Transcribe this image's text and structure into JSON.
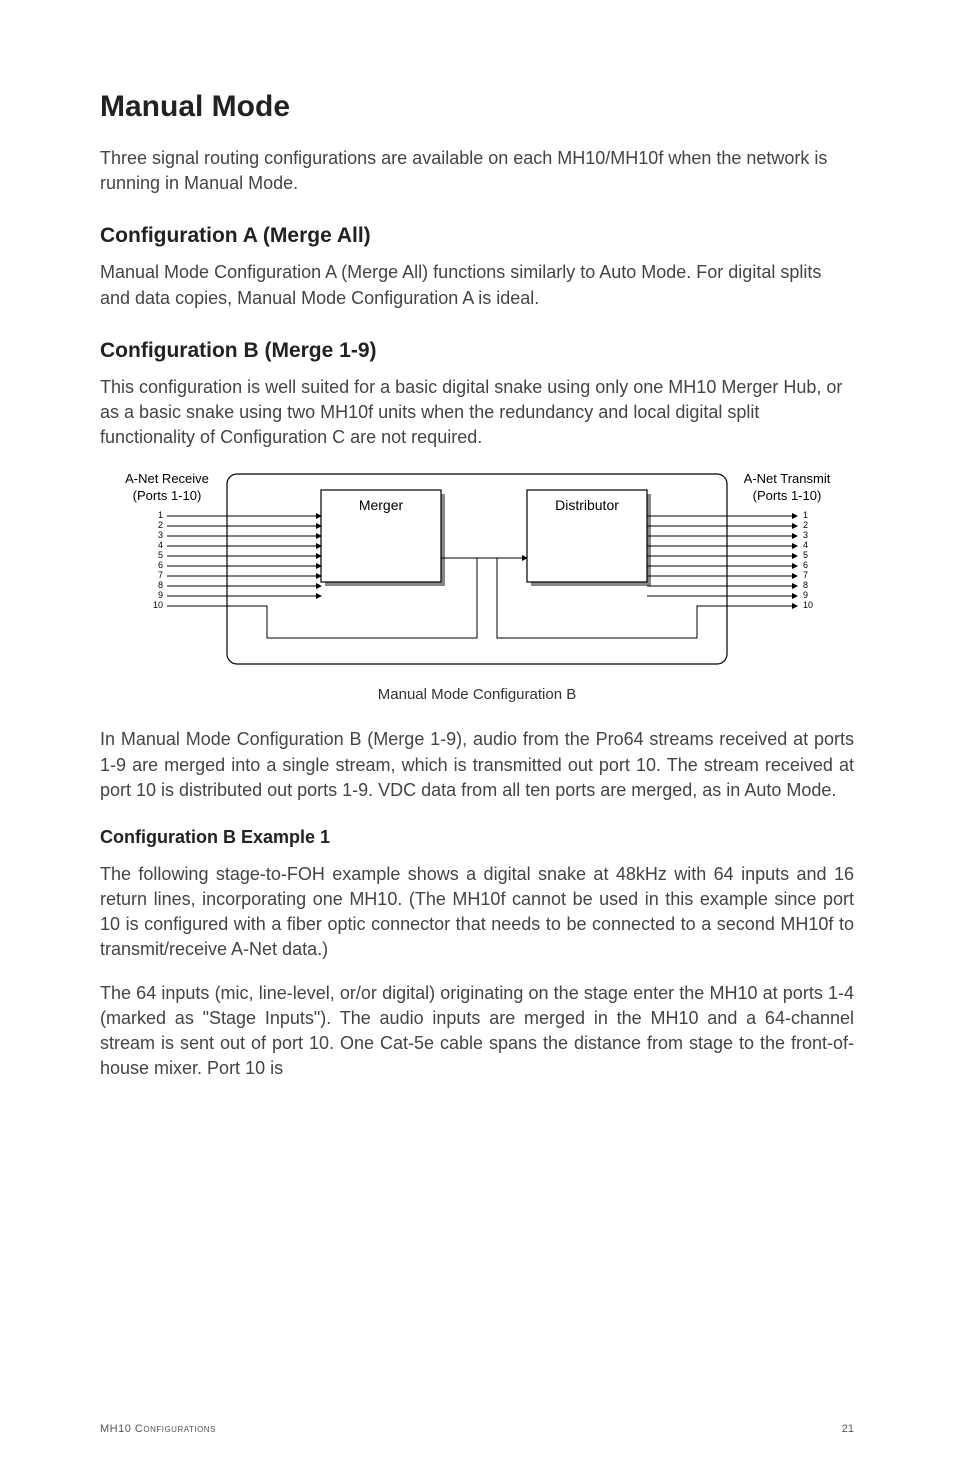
{
  "h1": "Manual Mode",
  "p_intro": "Three signal routing configurations are available on each MH10/MH10f when the network is running in Manual Mode.",
  "h2_a": "Configuration A (Merge All)",
  "p_a": "Manual Mode Configuration A (Merge All) functions similarly to Auto Mode. For digital splits and data copies, Manual Mode Configuration A is ideal.",
  "h2_b": "Configuration B (Merge 1-9)",
  "p_b_desc": "This configuration is well suited for a basic digital snake using only one MH10 Merger Hub, or as a basic snake using two MH10f units when the redundancy and local digital split functionality of Configuration C are not required.",
  "diagram": {
    "receive_label_top": "A-Net Receive",
    "receive_label_bottom": "(Ports 1-10)",
    "transmit_label_top": "A-Net Transmit",
    "transmit_label_bottom": "(Ports 1-10)",
    "merger_label": "Merger",
    "distributor_label": "Distributor",
    "port_numbers": [
      "1",
      "2",
      "3",
      "4",
      "5",
      "6",
      "7",
      "8",
      "9",
      "10"
    ]
  },
  "caption": "Manual Mode Configuration B",
  "p_b_detail": "In Manual Mode Configuration B (Merge 1-9), audio from the Pro64 streams received at ports 1-9 are merged into a single stream, which is transmitted out port 10. The stream received at port 10 is distributed out ports 1-9. VDC data from all ten ports are merged, as in Auto Mode.",
  "h3_ex1": "Configuration B Example 1",
  "p_ex1_a": "The following stage-to-FOH example shows a digital snake at 48kHz with 64 inputs and 16 return lines, incorporating one MH10. (The MH10f cannot be used in this example since port 10 is configured with a fiber optic connector that needs to be connected to a second MH10f to transmit/receive A-Net data.)",
  "p_ex1_b": "The 64 inputs (mic, line-level, or/or digital) originating on the stage enter the MH10 at ports 1-4 (marked as \"Stage Inputs\"). The audio inputs are merged in the MH10 and a 64-channel stream is sent out of port 10. One Cat-5e cable spans the distance from stage to the front-of-house mixer. Port 10 is",
  "footer_left": "MH10 Configurations",
  "footer_right": "21"
}
